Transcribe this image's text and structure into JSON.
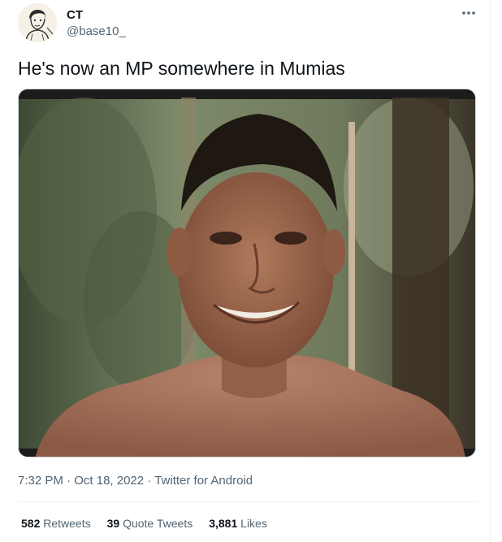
{
  "author": {
    "display_name": "CT",
    "handle": "@base10_",
    "avatar_icon": "sketch-portrait-avatar"
  },
  "menu": {
    "more_icon": "more-horizontal-icon"
  },
  "tweet": {
    "text": "He's now an MP somewhere in Mumias"
  },
  "media": {
    "icon": "photo-smiling-man-in-forest"
  },
  "meta": {
    "time": "7:32 PM",
    "separator": "·",
    "date": "Oct 18, 2022",
    "source": "Twitter for Android"
  },
  "stats": {
    "retweets_count": "582",
    "retweets_label": "Retweets",
    "quote_count": "39",
    "quote_label": "Quote Tweets",
    "likes_count": "3,881",
    "likes_label": "Likes"
  },
  "colors": {
    "primary_text": "#0f1419",
    "secondary_text": "#536471",
    "border": "#eff3f4"
  }
}
